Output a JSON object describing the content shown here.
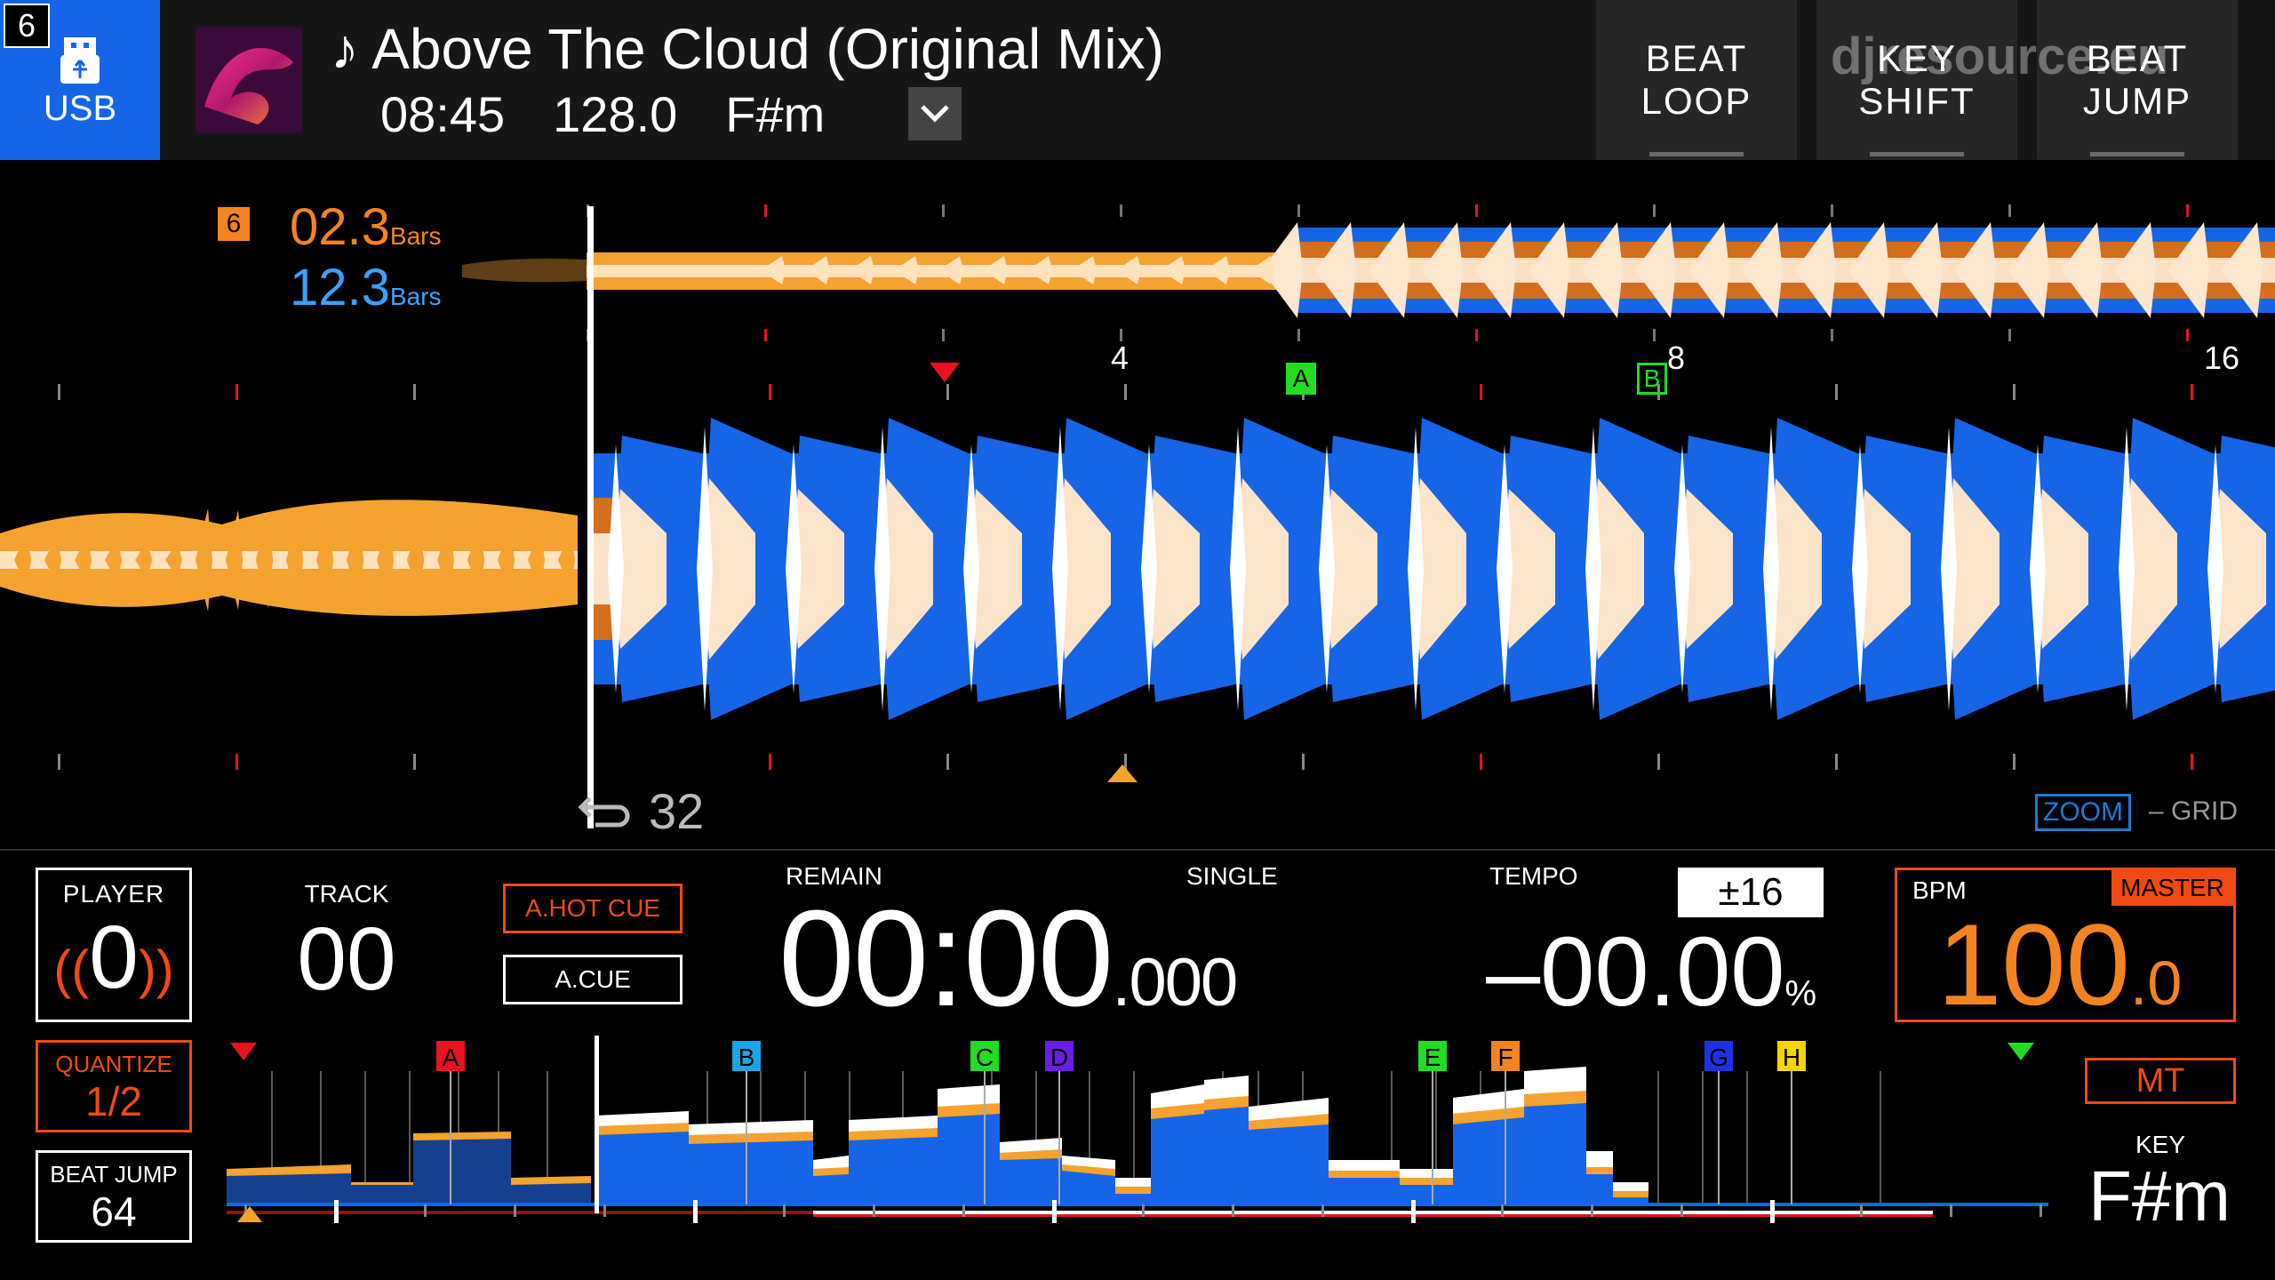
{
  "header": {
    "player_number": "6",
    "source_label": "USB",
    "track_title": "♪ Above The Cloud (Original Mix)",
    "track_length": "08:45",
    "track_bpm": "128.0",
    "track_key": "F#m",
    "buttons": [
      {
        "line1": "BEAT",
        "line2": "LOOP"
      },
      {
        "line1": "KEY",
        "line2": "SHIFT"
      },
      {
        "line1": "BEAT",
        "line2": "JUMP"
      }
    ],
    "watermark": "djresource.eu"
  },
  "waveform": {
    "beat_badge": "6",
    "bars_orange": "02.3",
    "bars_blue": "12.3",
    "bars_unit": "Bars",
    "beat_numbers": [
      "4",
      "8",
      "16"
    ],
    "cue_a": "A",
    "cue_b": "B",
    "loop_count": "32",
    "zoom_label": "ZOOM",
    "grid_label": "– GRID"
  },
  "panel": {
    "player_label": "PLAYER",
    "player_value": "0",
    "track_label": "TRACK",
    "track_value": "00",
    "hot_cue_button": "A.HOT CUE",
    "auto_cue_button": "A.CUE",
    "remain_label": "REMAIN",
    "single_label": "SINGLE",
    "time_main": "00:00",
    "time_ms": ".000",
    "tempo_label": "TEMPO",
    "tempo_range": "±16",
    "tempo_value": "–00.00",
    "tempo_unit": "%",
    "bpm_label": "BPM",
    "master_badge": "MASTER",
    "bpm_value": "100",
    "bpm_decimal": ".0",
    "quantize_label": "QUANTIZE",
    "quantize_value": "1/2",
    "beat_jump_label": "BEAT JUMP",
    "beat_jump_value": "64",
    "mt_button": "MT",
    "key_label": "KEY",
    "key_value": "F#m"
  },
  "overview": {
    "hot_cues": [
      {
        "label": "A",
        "color": "#e8131e"
      },
      {
        "label": "B",
        "color": "#19a6e6"
      },
      {
        "label": "C",
        "color": "#22dd22"
      },
      {
        "label": "D",
        "color": "#6a1ee6"
      },
      {
        "label": "E",
        "color": "#22dd22"
      },
      {
        "label": "F",
        "color": "#f5831f"
      },
      {
        "label": "G",
        "color": "#1c32e6"
      },
      {
        "label": "H",
        "color": "#f5d400"
      }
    ]
  },
  "colors": {
    "accent_orange": "#f5831f",
    "accent_red": "#f04a12",
    "wave_blue": "#1565e6",
    "usb_blue": "#1565e6"
  }
}
